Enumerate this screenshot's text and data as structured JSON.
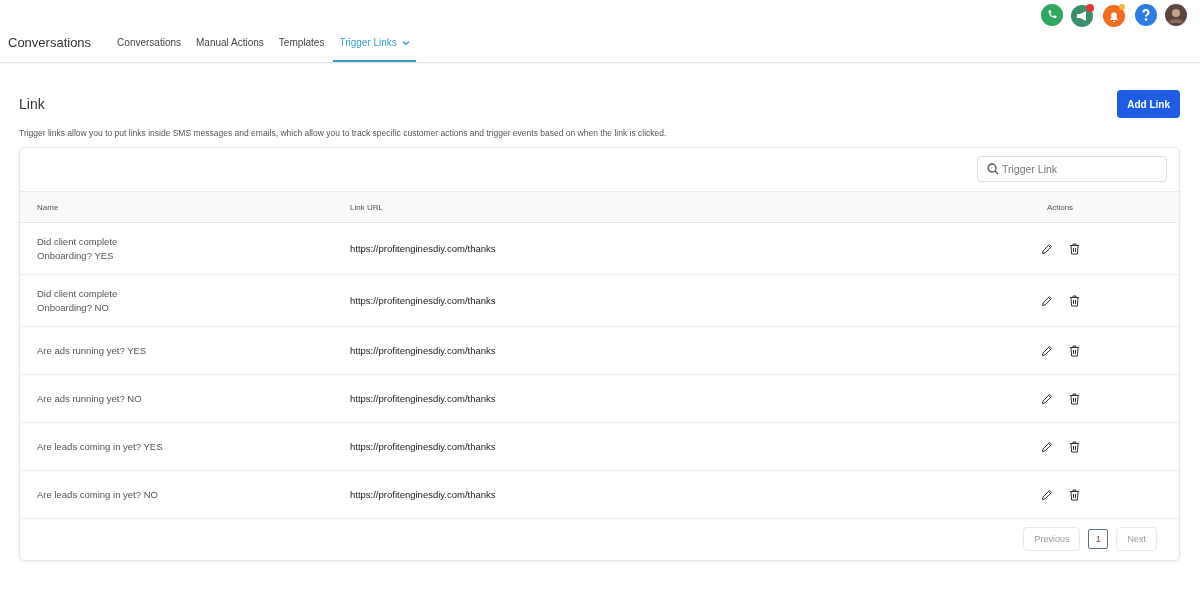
{
  "header": {
    "title": "Conversations",
    "tabs": [
      {
        "label": "Conversations",
        "selected": false,
        "dropdown": false
      },
      {
        "label": "Manual Actions",
        "selected": false,
        "dropdown": false
      },
      {
        "label": "Templates",
        "selected": false,
        "dropdown": false
      },
      {
        "label": "Trigger Links",
        "selected": true,
        "dropdown": true
      }
    ]
  },
  "page": {
    "title": "Link",
    "add_button": "Add Link",
    "description": "Trigger links allow you to put links inside SMS messages and emails, which allow you to track specific customer actions and trigger events based on when the link is clicked."
  },
  "search": {
    "placeholder": "Trigger Link"
  },
  "table": {
    "columns": [
      "Name",
      "Link URL",
      "Actions"
    ],
    "rows": [
      {
        "name_lines": [
          "Did client complete",
          "Onboarding? YES"
        ],
        "url": "https://profitenginesdiy.com/thanks"
      },
      {
        "name_lines": [
          "Did client complete",
          "Onboarding? NO"
        ],
        "url": "https://profitenginesdiy.com/thanks"
      },
      {
        "name_lines": [
          "Are ads running yet? YES"
        ],
        "url": "https://profitenginesdiy.com/thanks"
      },
      {
        "name_lines": [
          "Are ads running yet? NO"
        ],
        "url": "https://profitenginesdiy.com/thanks"
      },
      {
        "name_lines": [
          "Are leads coming in yet? YES"
        ],
        "url": "https://profitenginesdiy.com/thanks"
      },
      {
        "name_lines": [
          "Are leads coming in yet? NO"
        ],
        "url": "https://profitenginesdiy.com/thanks"
      }
    ]
  },
  "pagination": {
    "previous": {
      "label": "Previous",
      "disabled": true
    },
    "pages": [
      {
        "label": "1",
        "selected": true
      }
    ],
    "next": {
      "label": "Next",
      "disabled": true
    }
  }
}
